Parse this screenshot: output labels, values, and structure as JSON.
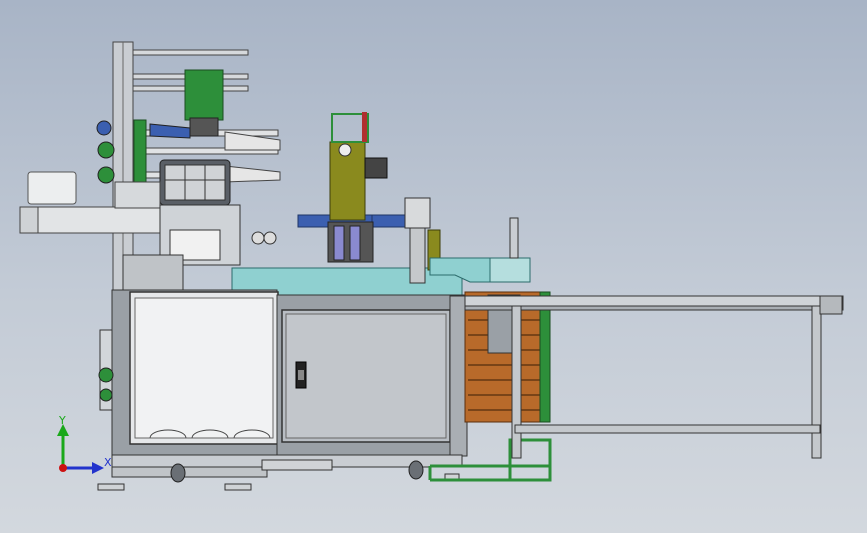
{
  "viewport": {
    "background_top": "#a8b4c6",
    "background_bottom": "#d3d8de"
  },
  "triad": {
    "y_label": "Y",
    "x_label": "X",
    "y_color": "#1aa81a",
    "x_color": "#2233cc",
    "z_color": "#cc1111"
  },
  "colors": {
    "frame_gray": "#9aa0a6",
    "panel_light": "#e6e8ea",
    "cabinet_gray": "#b9bec4",
    "accent_green": "#2d8f3a",
    "accent_olive": "#8a8a1e",
    "accent_blue": "#3b5fb0",
    "accent_cyan": "#8fd0d0",
    "conveyor_orange": "#b86a2a"
  }
}
